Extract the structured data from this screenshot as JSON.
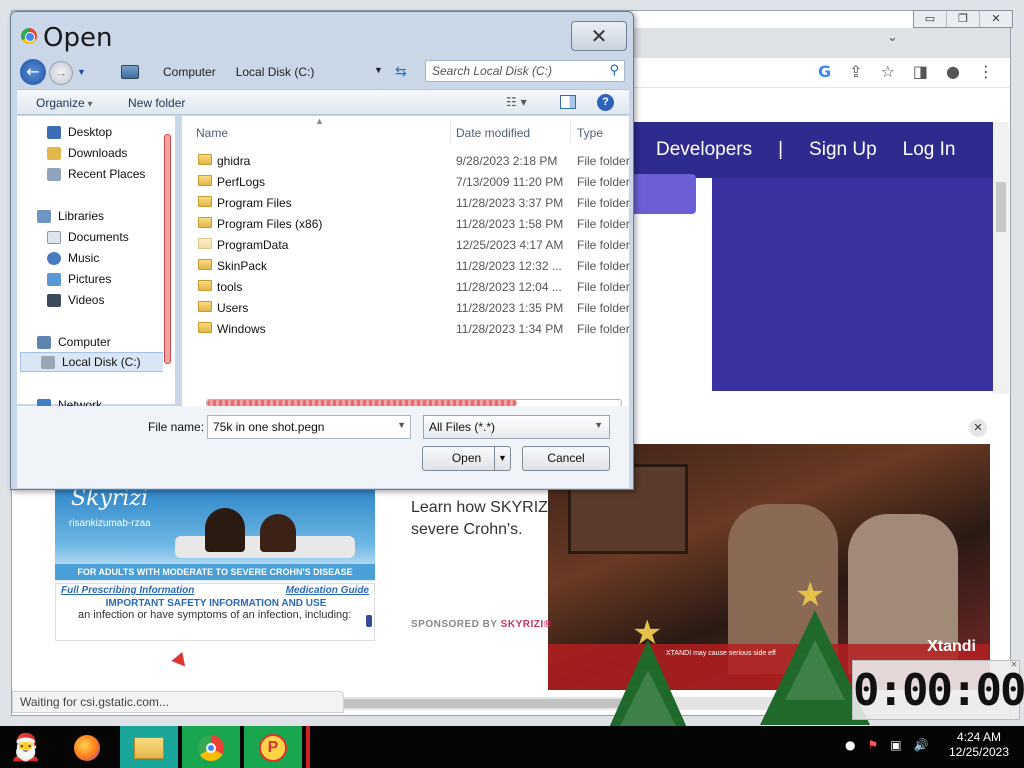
{
  "dialog": {
    "title": "Open",
    "close_glyph": "✕",
    "breadcrumb": [
      "Computer",
      "Local Disk (C:)"
    ],
    "search_placeholder": "Search Local Disk (C:)",
    "toolbar": {
      "organize": "Organize",
      "new_folder": "New folder",
      "views_glyph": "☷ ▾",
      "help": "?"
    },
    "nav": [
      {
        "label": "Desktop",
        "icon": "desktop-icon"
      },
      {
        "label": "Downloads",
        "icon": "downloads-icon"
      },
      {
        "label": "Recent Places",
        "icon": "recent-places-icon"
      },
      {
        "label": "Libraries",
        "icon": "libraries-icon"
      },
      {
        "label": "Documents",
        "icon": "documents-icon"
      },
      {
        "label": "Music",
        "icon": "music-icon"
      },
      {
        "label": "Pictures",
        "icon": "pictures-icon"
      },
      {
        "label": "Videos",
        "icon": "videos-icon"
      },
      {
        "label": "Computer",
        "icon": "computer-icon"
      },
      {
        "label": "Local Disk (C:)",
        "icon": "drive-icon"
      },
      {
        "label": "Network",
        "icon": "network-icon"
      }
    ],
    "columns": {
      "name": "Name",
      "date": "Date modified",
      "type": "Type"
    },
    "files": [
      {
        "name": "ghidra",
        "date": "9/28/2023 2:18 PM",
        "type": "File folder"
      },
      {
        "name": "PerfLogs",
        "date": "7/13/2009 11:20 PM",
        "type": "File folder"
      },
      {
        "name": "Program Files",
        "date": "11/28/2023 3:37 PM",
        "type": "File folder"
      },
      {
        "name": "Program Files (x86)",
        "date": "11/28/2023 1:58 PM",
        "type": "File folder"
      },
      {
        "name": "ProgramData",
        "date": "12/25/2023 4:17 AM",
        "type": "File folder"
      },
      {
        "name": "SkinPack",
        "date": "11/28/2023 12:32 ...",
        "type": "File folder"
      },
      {
        "name": "tools",
        "date": "11/28/2023 12:04 ...",
        "type": "File folder"
      },
      {
        "name": "Users",
        "date": "11/28/2023 1:35 PM",
        "type": "File folder"
      },
      {
        "name": "Windows",
        "date": "11/28/2023 1:34 PM",
        "type": "File folder"
      }
    ],
    "file_name_label": "File name:",
    "file_name_value": "75k in one shot.pegn",
    "file_type_value": "All Files (*.*)",
    "open_label": "Open",
    "cancel_label": "Cancel"
  },
  "browser": {
    "nav_links": [
      "Developers",
      "|",
      "Sign Up",
      "Log In"
    ],
    "status": "Waiting for csi.gstatic.com...",
    "ad_text_lines": [
      "Learn how SKYRIZI",
      "severe Crohn's."
    ],
    "sponsored_prefix": "SPONSORED BY ",
    "sponsored_brand": "SKYRIZI®",
    "skyrizi": {
      "brand": "Skyrizi",
      "generic": "risankizumab-rzaa",
      "banner": "FOR ADULTS WITH MODERATE TO SEVERE CROHN'S DISEASE",
      "link_fpi": "Full Prescribing Information",
      "link_med": "Medication Guide",
      "safety": "IMPORTANT SAFETY INFORMATION AND USE",
      "body": "an infection or have symptoms of an infection, including:"
    },
    "video": {
      "caption": "XTANDI may cause serious side eff",
      "logo": "Xtandi"
    }
  },
  "timer": "0:00:00",
  "taskbar": {
    "clock_time": "4:24 AM",
    "clock_date": "12/25/2023",
    "apps": [
      "santa-icon",
      "firefox-icon",
      "file-explorer-icon",
      "chrome-icon",
      "paint-icon"
    ]
  }
}
